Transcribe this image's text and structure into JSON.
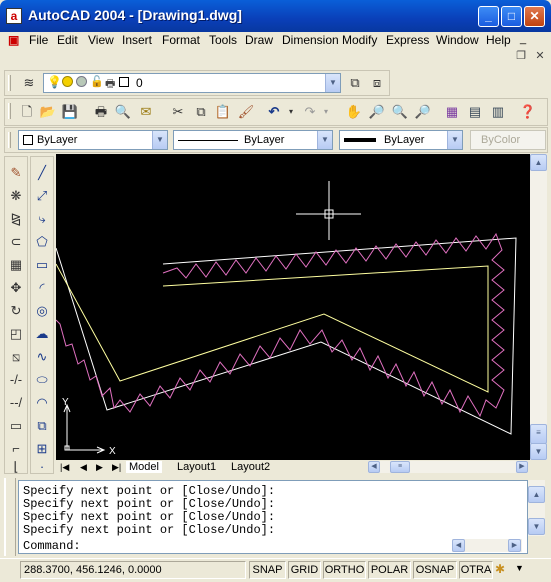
{
  "window": {
    "title": "AutoCAD 2004 - [Drawing1.dwg]",
    "app_icon": "a"
  },
  "window_buttons": {
    "minimize": "_",
    "maximize": "□",
    "close": "✕"
  },
  "menu": [
    "File",
    "Edit",
    "View",
    "Insert",
    "Format",
    "Tools",
    "Draw",
    "Dimension",
    "Modify",
    "Express",
    "Window",
    "Help"
  ],
  "mdi_buttons": {
    "minimize": "_",
    "restore": "❐",
    "close": "✕"
  },
  "layer": {
    "current": "0"
  },
  "properties": {
    "color": "ByLayer",
    "linetype": "ByLayer",
    "lineweight": "ByLayer",
    "plotstyle": "ByColor"
  },
  "layout_tabs": [
    "Model",
    "Layout1",
    "Layout2"
  ],
  "ucs": {
    "x": "X",
    "y": "Y"
  },
  "command": {
    "history": [
      "Specify next point or [Close/Undo]:",
      "Specify next point or [Close/Undo]:",
      "Specify next point or [Close/Undo]:",
      "Specify next point or [Close/Undo]:"
    ],
    "prompt": "Command:"
  },
  "status": {
    "coords": "288.3700, 456.1246, 0.0000",
    "buttons": [
      "SNAP",
      "GRID",
      "ORTHO",
      "POLAR",
      "OSNAP",
      "OTRA"
    ]
  },
  "colors": {
    "drawing_bg": "#000000",
    "polyline": "#ffffa0",
    "zigzag": "#e070c0",
    "outer": "#ffffff"
  }
}
